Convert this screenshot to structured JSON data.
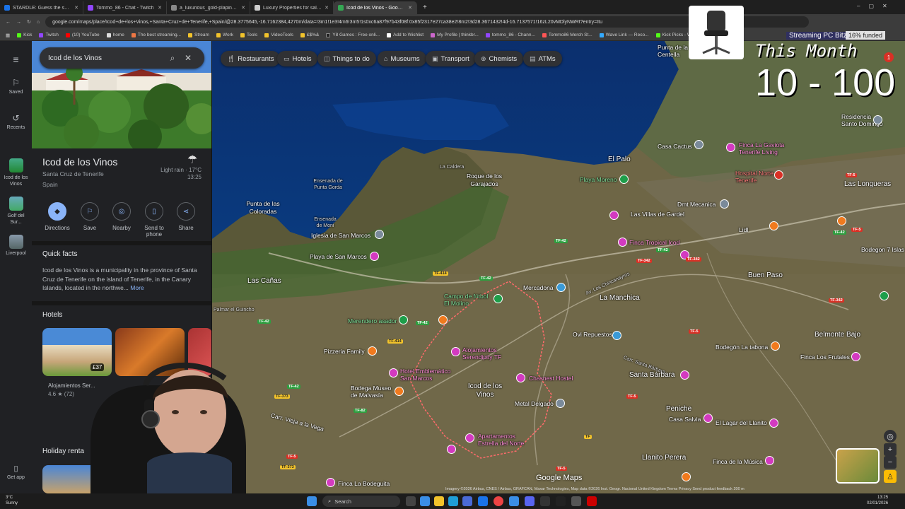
{
  "browser": {
    "tabs": [
      {
        "title": "STARDLE: Guess the ship!",
        "color": "#1a73e8"
      },
      {
        "title": "Tommo_86 - Chat - Twitch",
        "color": "#9146ff"
      },
      {
        "title": "a_luxurious_gold-plaping (960×",
        "color": "#888888"
      },
      {
        "title": "Luxury Properties for sale in Te",
        "color": "#cccccc"
      },
      {
        "title": "Icod de los Vinos - Google Map",
        "color": "#34a853",
        "active": true
      }
    ],
    "url": "google.com/maps/place/Icod+de+los+Vinos,+Santa+Cruz+de+Tenerife,+Spain/@28.3775645,-16.7162384,4270m/data=!3m1!1e3!4m6!3m5!1s0xc6a87f97b43f08f:0x85f2317e27ca38e2!8m2!3d28.3671432!4d-16.7137571!16zL20vMDlyNWRt?entry=ttu",
    "bookmarks": [
      "Kick",
      "Twitch",
      "(10) YouTube",
      "home",
      "The best streaming...",
      "Stream",
      "Work",
      "Tools",
      "VideoTools",
      "£$%&",
      "Y8 Games : Free onli...",
      "Add to Wishlist",
      "My Profile | thinkbr...",
      "tommo_86 - Chann...",
      "Tommo86 Merch St...",
      "Wave Link — Reco...",
      "Kick Picks - Week 3..."
    ]
  },
  "rail": {
    "menu_icon": "menu-icon",
    "saved": "Saved",
    "recents": "Recents",
    "recent_places": [
      "Icod de los Vinos",
      "Golf del Sur...",
      "Liverpool"
    ],
    "get_app": "Get app"
  },
  "panel": {
    "search_value": "Icod de los Vinos",
    "title": "Icod de los Vinos",
    "subtitle1": "Santa Cruz de Tenerife",
    "subtitle2": "Spain",
    "weather": "Light rain · 17°C",
    "weather_time": "13:25",
    "actions": [
      "Directions",
      "Save",
      "Nearby",
      "Send to phone",
      "Share"
    ],
    "quick_facts_title": "Quick facts",
    "quick_facts_body": "Icod de los Vinos is a municipality in the province of Santa Cruz de Tenerife on the island of Tenerife, in the Canary Islands, located in the northwe...",
    "quick_facts_more": "More",
    "hotels_title": "Hotels",
    "hotel_price": "£37",
    "hotel_name": "Alojamientos Ser...",
    "hotel_rating": "4.6 ★ (72)",
    "holiday_title": "Holiday renta"
  },
  "map": {
    "chips": [
      "Restaurants",
      "Hotels",
      "Things to do",
      "Museums",
      "Transport",
      "Chemists",
      "ATMs"
    ],
    "labels": {
      "punta_centella": "Punta de la Centella",
      "casa_cactus": "Casa Cactus",
      "finca_gaviota": "Finca La Gaviota Tenerife Living",
      "residencia": "Residencia Santo Domingo",
      "el_palo": "El Palo",
      "la_caldera": "La Caldera",
      "roque": "Roque de los Garajados",
      "playa_moreno": "Playa Moreno",
      "hospital": "Hospital Norte Tenerife",
      "las_longueras": "Las Longueras",
      "ensenada_garda": "Ensenada de Punta Gorda",
      "punta_coloradas": "Punta de las Coloradas",
      "ensenada_moni": "Ensenada de Moni",
      "iglesia": "Iglesia de San Marcos",
      "playa_san_marcos": "Playa de San Marcos",
      "villas_gardel": "Las Villas de Gardel",
      "dmt": "Dmt Mecanica",
      "tropical": "Finca Tropical Icod",
      "lidl": "Lidl",
      "bodegon_7": "Bodegon 7 Islas",
      "buen_paso": "Buen Paso",
      "las_canas": "Las Cañas",
      "mercadona": "Mercadona",
      "la_manchica": "La Manchica",
      "campo": "Campo de fútbol El Molino",
      "merendero": "Merendero asador",
      "guincho": "Palmar el Guincho",
      "pizzeria": "Pizzeria Family",
      "alojamientos": "Alojamientos Serendipity TF",
      "hotel_emb": "Hotel Emblemático San Marcos",
      "chasnest": "Chasnest Hostel",
      "ovi": "Ovi Repuestos",
      "bodegon_tabona": "Bodegón La tabona",
      "belmonte": "Belmonte Bajo",
      "finca_frutales": "Finca Los Frutales",
      "icod": "Icod de los Vinos",
      "santa_barbara": "Santa Bárbara",
      "bodega_museo": "Bodega Museo de Malvasía",
      "metal_delgado": "Metal Delgado",
      "peniche": "Peniche",
      "casa_salvia": "Casa Salvia",
      "lagar": "El Lagar del Llanito",
      "vieja_vega": "Carr. Vieja a la Vega",
      "apart_norte": "Apartamentos Estrella del Norte",
      "llanito": "Llanito Perera",
      "finca_musica": "Finca de la Música",
      "bodeguita": "Finca La Bodeguita",
      "chincanayros": "Av. Los Chincanayros",
      "carr_barbara": "Carr. Santa Bárbara"
    },
    "brand": "Google Maps",
    "attribution": "Imagery ©2026 Airbus, CNES / Airbus, GRAFCAN, Maxar Technologies, Map data ©2026 Inst. Geogr. Nacional   United Kingdom   Terms   Privacy   Send product feedback   200 m"
  },
  "overlay": {
    "streaming": "Streaming PC Bitz",
    "funded": "16% funded",
    "month": "This Month",
    "range": "10 - 100"
  },
  "taskbar": {
    "temp": "3°C",
    "cond": "Sunny",
    "search": "Search",
    "time": "13:25",
    "date": "02/01/2026"
  }
}
